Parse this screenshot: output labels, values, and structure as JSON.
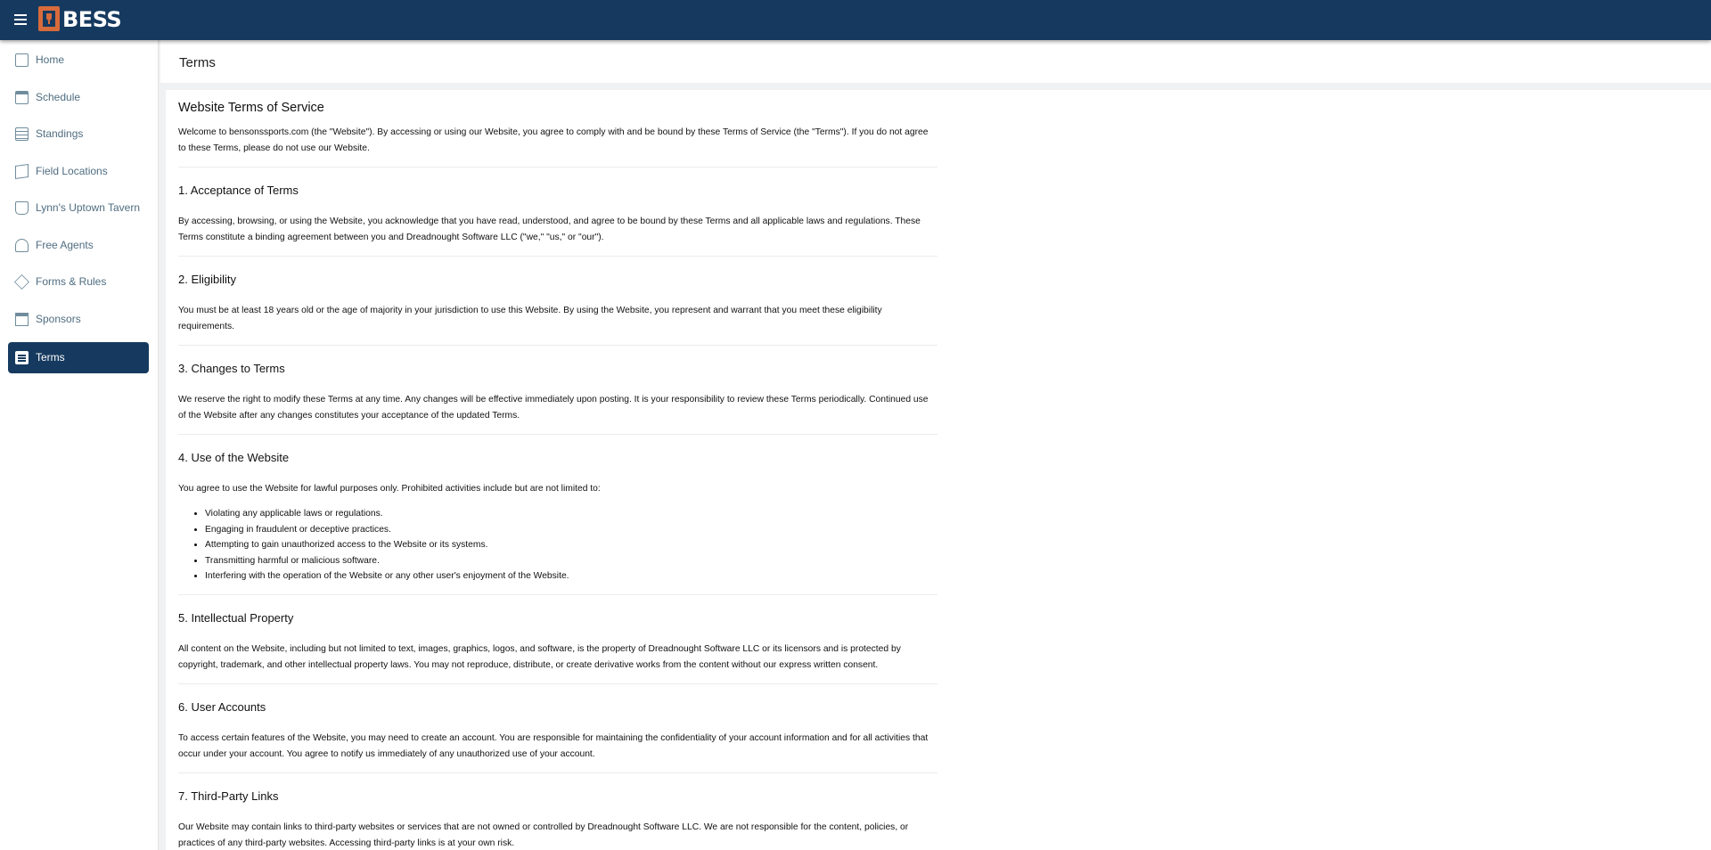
{
  "app": {
    "logo_text": "BESS",
    "menu_icon": "menu-icon"
  },
  "sidebar": {
    "items": [
      {
        "label": "Home",
        "icon": "copy-icon",
        "active": false
      },
      {
        "label": "Schedule",
        "icon": "calendar-icon",
        "active": false
      },
      {
        "label": "Standings",
        "icon": "clipboard-icon",
        "active": false
      },
      {
        "label": "Field Locations",
        "icon": "map-icon",
        "active": false
      },
      {
        "label": "Lynn's Uptown Tavern",
        "icon": "mug-icon",
        "active": false
      },
      {
        "label": "Free Agents",
        "icon": "add-user-icon",
        "active": false
      },
      {
        "label": "Forms & Rules",
        "icon": "gavel-icon",
        "active": false
      },
      {
        "label": "Sponsors",
        "icon": "store-icon",
        "active": false
      },
      {
        "label": "Terms",
        "icon": "article-icon",
        "active": true
      }
    ]
  },
  "page": {
    "title": "Terms"
  },
  "terms": {
    "heading": "Website Terms of Service",
    "intro": "Welcome to bensonssports.com (the \"Website\"). By accessing or using our Website, you agree to comply with and be bound by these Terms of Service (the \"Terms\"). If you do not agree to these Terms, please do not use our Website.",
    "sections": [
      {
        "title": "1. Acceptance of Terms",
        "body": "By accessing, browsing, or using the Website, you acknowledge that you have read, understood, and agree to be bound by these Terms and all applicable laws and regulations. These Terms constitute a binding agreement between you and Dreadnought Software LLC (\"we,\" \"us,\" or \"our\")."
      },
      {
        "title": "2. Eligibility",
        "body": "You must be at least 18 years old or the age of majority in your jurisdiction to use this Website. By using the Website, you represent and warrant that you meet these eligibility requirements."
      },
      {
        "title": "3. Changes to Terms",
        "body": "We reserve the right to modify these Terms at any time. Any changes will be effective immediately upon posting. It is your responsibility to review these Terms periodically. Continued use of the Website after any changes constitutes your acceptance of the updated Terms."
      },
      {
        "title": "4. Use of the Website",
        "body": "You agree to use the Website for lawful purposes only. Prohibited activities include but are not limited to:",
        "list": [
          "Violating any applicable laws or regulations.",
          "Engaging in fraudulent or deceptive practices.",
          "Attempting to gain unauthorized access to the Website or its systems.",
          "Transmitting harmful or malicious software.",
          "Interfering with the operation of the Website or any other user's enjoyment of the Website."
        ]
      },
      {
        "title": "5. Intellectual Property",
        "body": "All content on the Website, including but not limited to text, images, graphics, logos, and software, is the property of Dreadnought Software LLC or its licensors and is protected by copyright, trademark, and other intellectual property laws. You may not reproduce, distribute, or create derivative works from the content without our express written consent."
      },
      {
        "title": "6. User Accounts",
        "body": "To access certain features of the Website, you may need to create an account. You are responsible for maintaining the confidentiality of your account information and for all activities that occur under your account. You agree to notify us immediately of any unauthorized use of your account."
      },
      {
        "title": "7. Third-Party Links",
        "body": "Our Website may contain links to third-party websites or services that are not owned or controlled by Dreadnought Software LLC. We are not responsible for the content, policies, or practices of any third-party websites. Accessing third-party links is at your own risk."
      }
    ]
  }
}
